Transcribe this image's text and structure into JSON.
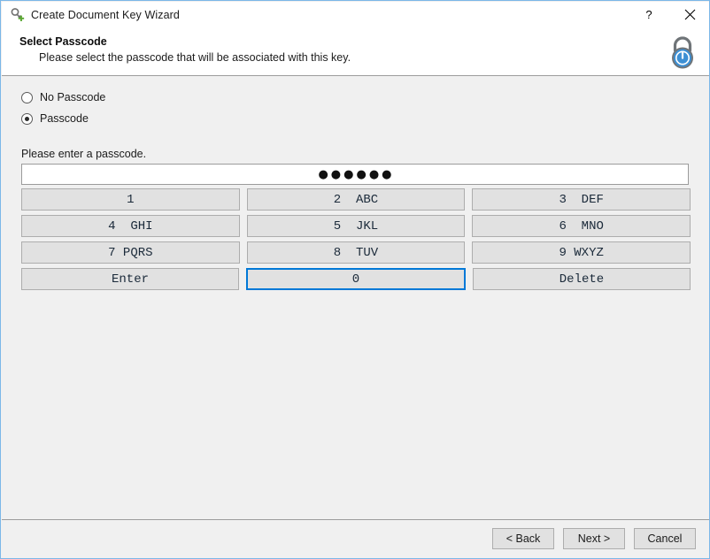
{
  "titlebar": {
    "icon": "key-add-icon",
    "title": "Create Document Key Wizard",
    "help_label": "?",
    "close_label": "✕"
  },
  "header": {
    "title": "Select Passcode",
    "subtitle": "Please select the passcode that will be associated with this key.",
    "icon": "padlock-icon"
  },
  "options": {
    "no_passcode_label": "No Passcode",
    "passcode_label": "Passcode",
    "selected": "passcode"
  },
  "passcode": {
    "field_label": "Please enter a passcode.",
    "value_mask": "●●●●●●",
    "length": 6,
    "placeholder": ""
  },
  "keypad": {
    "rows": [
      [
        {
          "label": "1",
          "digit": "1",
          "letters": "",
          "focused": false
        },
        {
          "label": "2  ABC",
          "digit": "2",
          "letters": "ABC",
          "focused": false
        },
        {
          "label": "3  DEF",
          "digit": "3",
          "letters": "DEF",
          "focused": false
        }
      ],
      [
        {
          "label": "4  GHI",
          "digit": "4",
          "letters": "GHI",
          "focused": false
        },
        {
          "label": "5  JKL",
          "digit": "5",
          "letters": "JKL",
          "focused": false
        },
        {
          "label": "6  MNO",
          "digit": "6",
          "letters": "MNO",
          "focused": false
        }
      ],
      [
        {
          "label": "7 PQRS",
          "digit": "7",
          "letters": "PQRS",
          "focused": false
        },
        {
          "label": "8  TUV",
          "digit": "8",
          "letters": "TUV",
          "focused": false
        },
        {
          "label": "9 WXYZ",
          "digit": "9",
          "letters": "WXYZ",
          "focused": false
        }
      ],
      [
        {
          "label": "Enter",
          "digit": "",
          "letters": "",
          "focused": false
        },
        {
          "label": "0",
          "digit": "0",
          "letters": "",
          "focused": true
        },
        {
          "label": "Delete",
          "digit": "",
          "letters": "",
          "focused": false
        }
      ]
    ]
  },
  "footer": {
    "back_label": "< Back",
    "next_label": "Next >",
    "cancel_label": "Cancel"
  },
  "colors": {
    "window_border": "#7BB7E8",
    "focus_accent": "#0078D7",
    "body_bg": "#F0F0F0",
    "button_bg": "#E1E1E1",
    "button_border": "#ADADAD",
    "separator": "#9C9C9C",
    "lock_blue": "#3C8FD4"
  }
}
